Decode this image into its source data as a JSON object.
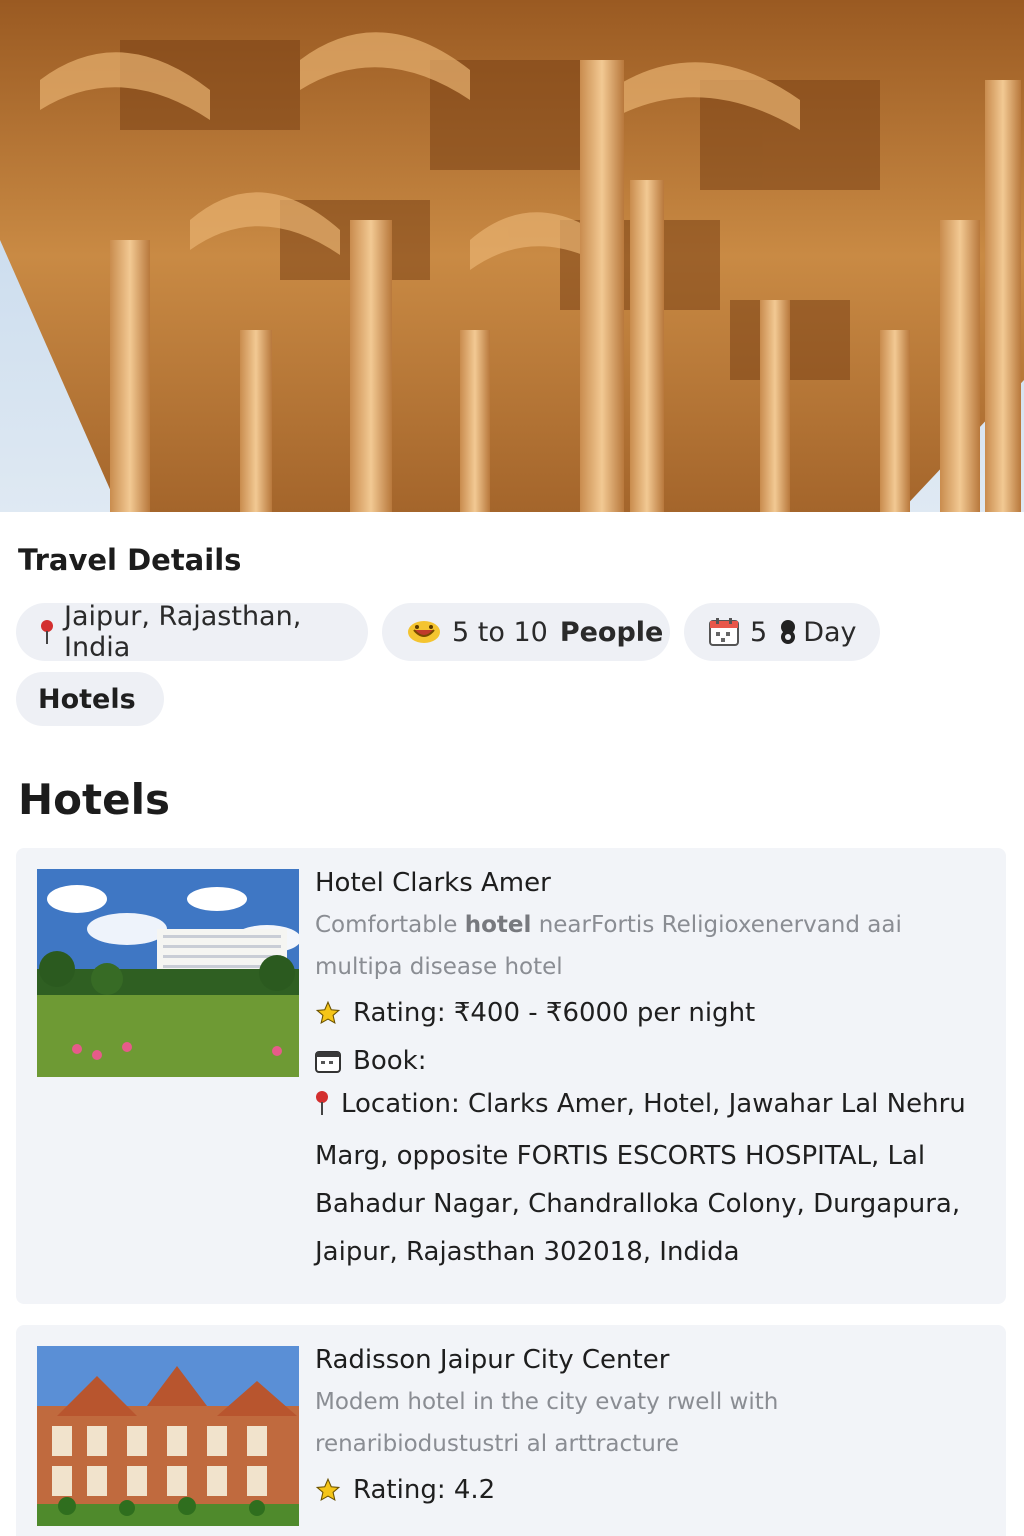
{
  "travel_details": {
    "title": "Travel Details",
    "location": "Jaipur, Rajasthan, India",
    "people_range": "5 to 10",
    "people_word": "People",
    "days_num": "5",
    "days_label": "Day",
    "category": "Hotels"
  },
  "hotels_section": {
    "heading": "Hotels",
    "items": [
      {
        "name": "Hotel Clarks Amer",
        "desc_prefix": "Comfortable ",
        "desc_bold": "hotel",
        "desc_rest": " nearFortis Religioxenervand aai multipa disease hotel",
        "rating_label": "Rating: ₹400 - ₹6000 per night",
        "book_label": "Book:",
        "location_label": "Location: Clarks Amer, Hotel, Jawahar Lal Nehru Marg, opposite FORTIS ESCORTS HOSPITAL, Lal Bahadur Nagar, Chandralloka Colony, Durgapura, Jaipur, Rajasthan 302018, Indida"
      },
      {
        "name": "Radisson Jaipur City Center",
        "desc": "Modem hotel in the city evaty rwell with renaribiodustustri al arttracture",
        "rating_label": "Rating: 4.2"
      }
    ]
  },
  "colors": {
    "chip_bg": "#eef0f5",
    "card_bg": "#f2f4f8",
    "pin": "#d32f2f",
    "star": "#f5c518"
  }
}
